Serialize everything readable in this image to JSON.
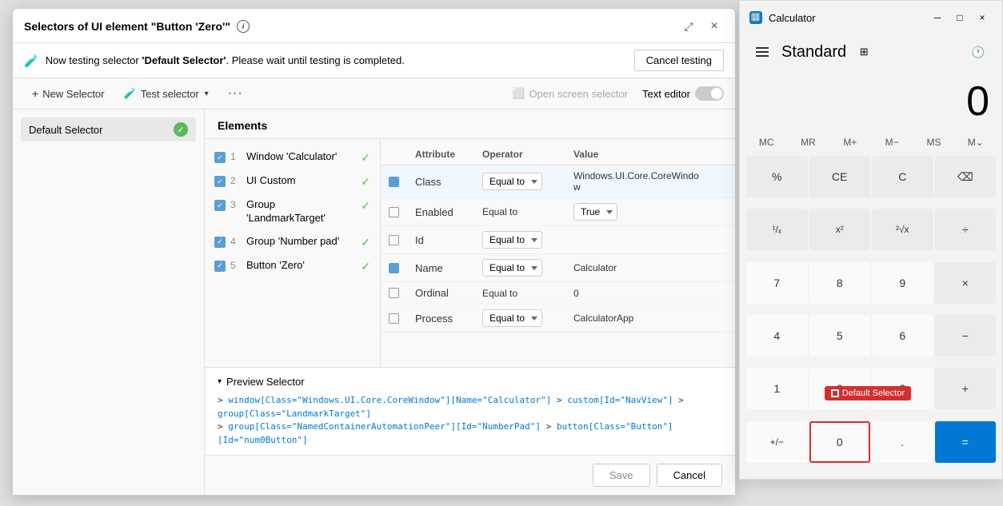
{
  "dialog": {
    "title": "Selectors of UI element \"Button 'Zero'\"",
    "info_icon": "i",
    "close_btn": "×",
    "restore_btn": "⤢"
  },
  "banner": {
    "text_before": "Now testing selector ",
    "selector_name": "'Default Selector'",
    "text_after": ". Please wait until testing is completed.",
    "cancel_btn": "Cancel testing"
  },
  "toolbar": {
    "new_selector": "New Selector",
    "test_selector": "Test selector",
    "open_screen": "Open screen selector",
    "text_editor": "Text editor",
    "more_options": "..."
  },
  "left_panel": {
    "selector_label": "Default Selector"
  },
  "elements": {
    "header": "Elements",
    "items": [
      {
        "num": "1",
        "name": "Window 'Calculator'",
        "checked": true
      },
      {
        "num": "2",
        "name": "UI Custom",
        "checked": true
      },
      {
        "num": "3",
        "name": "Group 'LandmarkTarget'",
        "checked": true
      },
      {
        "num": "4",
        "name": "Group 'Number pad'",
        "checked": true
      },
      {
        "num": "5",
        "name": "Button 'Zero'",
        "checked": true
      }
    ]
  },
  "attributes": {
    "columns": [
      "Attribute",
      "Operator",
      "Value"
    ],
    "rows": [
      {
        "checked": true,
        "name": "Class",
        "operator": "Equal to",
        "value": "Windows.UI.Core.CoreWindow",
        "highlighted": true
      },
      {
        "checked": false,
        "name": "Enabled",
        "operator": "Equal to",
        "value": "True",
        "highlighted": false
      },
      {
        "checked": false,
        "name": "Id",
        "operator": "Equal to",
        "value": "",
        "highlighted": false
      },
      {
        "checked": true,
        "name": "Name",
        "operator": "Equal to",
        "value": "Calculator",
        "highlighted": false
      },
      {
        "checked": false,
        "name": "Ordinal",
        "operator": "Equal to",
        "value": "0",
        "highlighted": false
      },
      {
        "checked": false,
        "name": "Process",
        "operator": "Equal to",
        "value": "CalculatorApp",
        "highlighted": false
      }
    ]
  },
  "preview": {
    "header": "Preview Selector",
    "line1_before": "> ",
    "line1_code": "window[Class=\"Windows.UI.Core.CoreWindow\"][Name=\"Calculator\"]",
    "line1_mid": " > ",
    "line1_custom": "custom[Id=\"NavView\"]",
    "line1_mid2": " > ",
    "line1_group": "group[Class=\"LandmarkTarget\"]",
    "line2_before": "> ",
    "line2_group2": "group[Class=\"NamedContainerAutomationPeer\"][Id=\"NumberPad\"]",
    "line2_mid": " > ",
    "line2_button": "button[Class=\"Button\"][Id=\"num0Button\"]"
  },
  "footer": {
    "save_btn": "Save",
    "cancel_btn": "Cancel"
  },
  "calculator": {
    "title": "Calculator",
    "mode": "Standard",
    "display_value": "0",
    "memory_buttons": [
      "MC",
      "MR",
      "M+",
      "M−",
      "MS",
      "M⌄"
    ],
    "buttons": [
      [
        "%",
        "CE",
        "C",
        "⌫"
      ],
      [
        "¹/ₓ",
        "x²",
        "²√x",
        "÷"
      ],
      [
        "7",
        "8",
        "9",
        "×"
      ],
      [
        "4",
        "5",
        "6",
        "−"
      ],
      [
        "1",
        "2",
        "3",
        "+"
      ],
      [
        "+/−",
        "0",
        ".",
        "="
      ]
    ],
    "zero_btn_label": "0",
    "equals_btn_label": "="
  },
  "default_selector_badge": {
    "label": "Default Selector"
  }
}
